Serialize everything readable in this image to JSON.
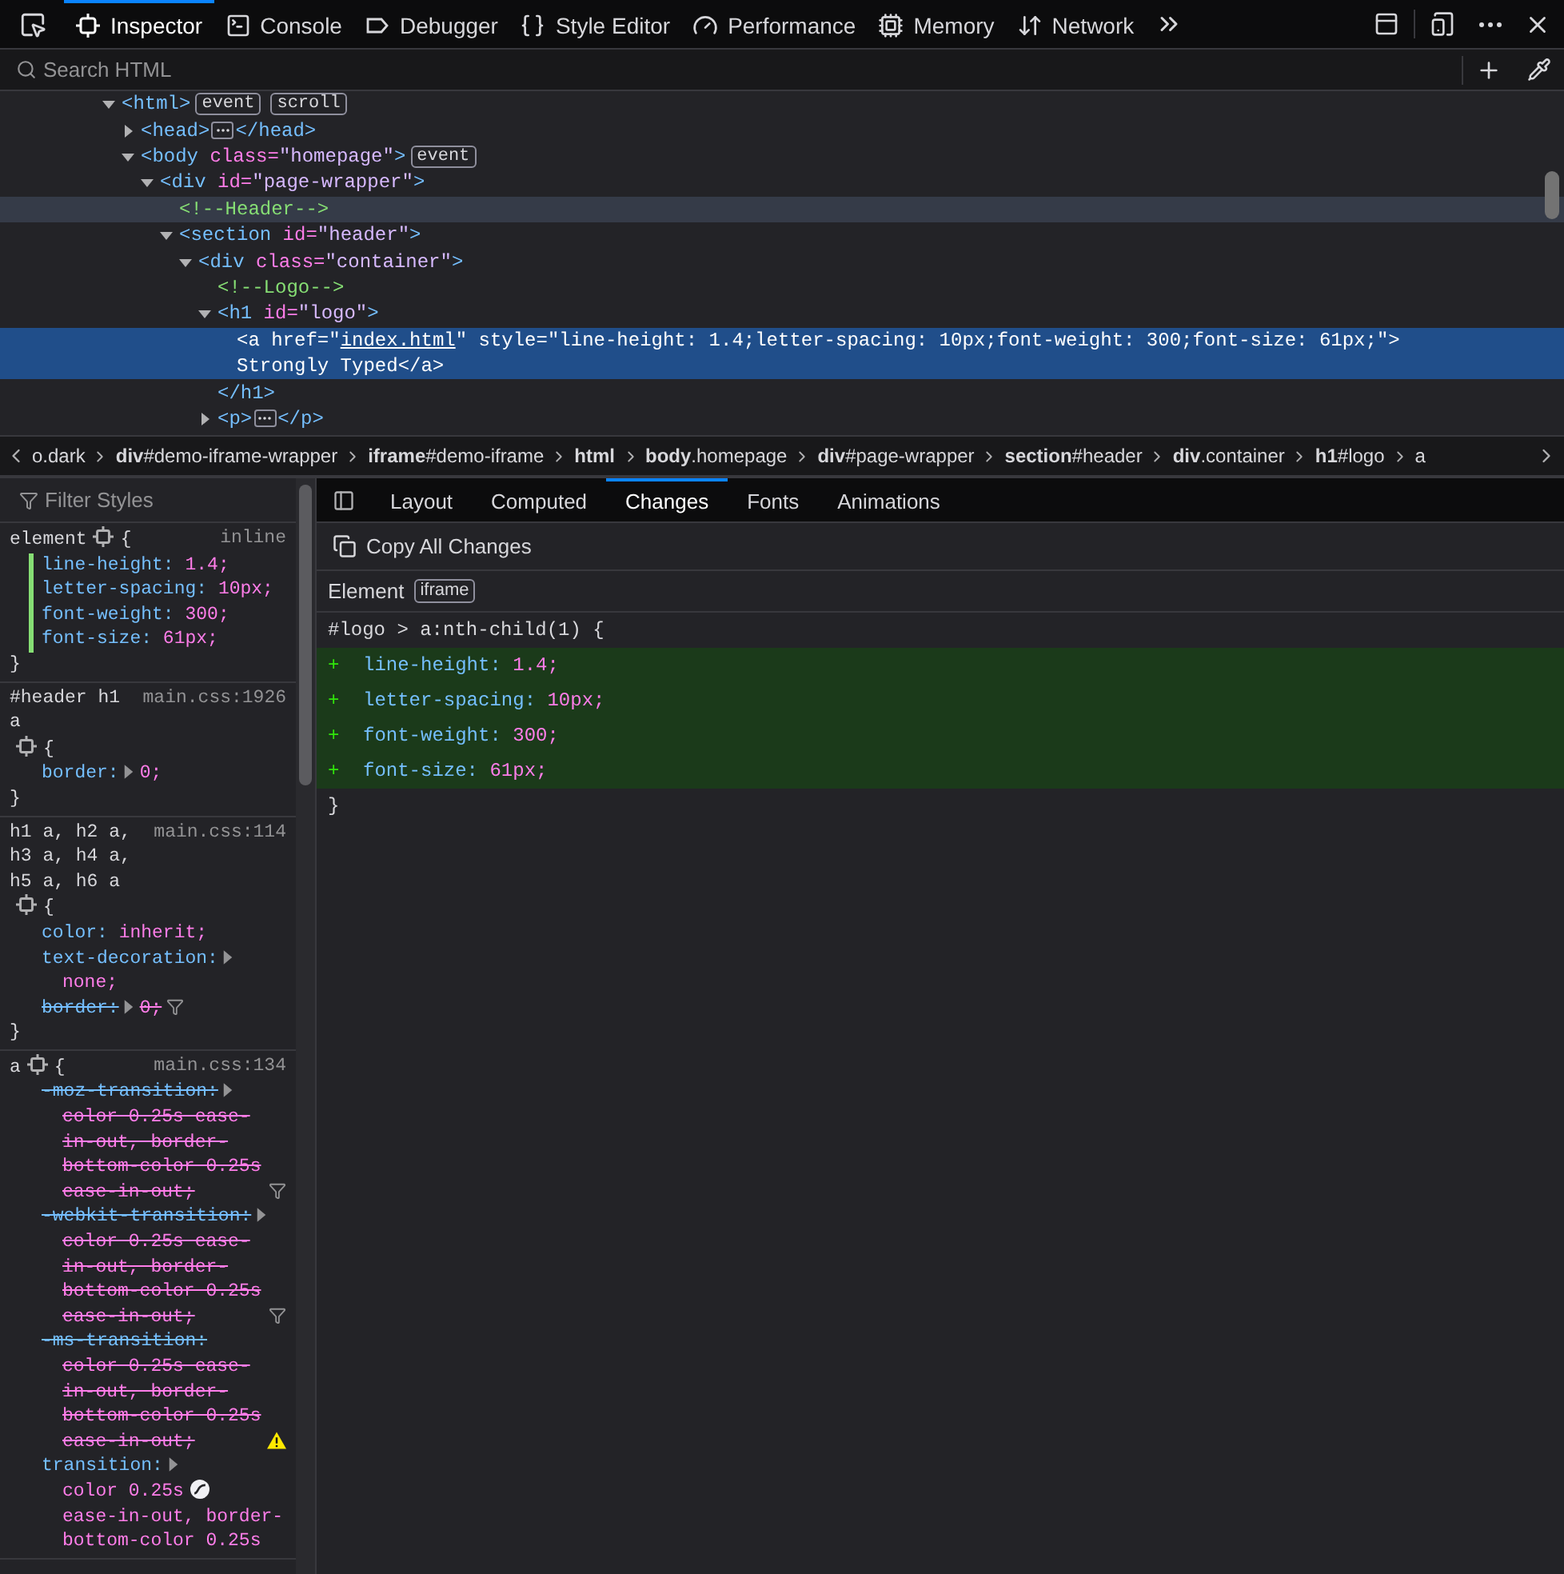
{
  "toolbar": {
    "tabs": [
      {
        "kind": "inspector",
        "label": "Inspector",
        "selected": true
      },
      {
        "kind": "console",
        "label": "Console",
        "selected": false
      },
      {
        "kind": "debugger",
        "label": "Debugger",
        "selected": false
      },
      {
        "kind": "style-editor",
        "label": "Style Editor",
        "selected": false
      },
      {
        "kind": "performance",
        "label": "Performance",
        "selected": false
      },
      {
        "kind": "memory",
        "label": "Memory",
        "selected": false
      },
      {
        "kind": "network",
        "label": "Network",
        "selected": false
      }
    ]
  },
  "search": {
    "placeholder": "Search HTML"
  },
  "markup": {
    "nodes": [
      {
        "expanded": true,
        "selected": false,
        "hovered": false,
        "lines": [
          [
            {
              "kind": "tag",
              "text": "<html>"
            },
            {
              "kind": "badge",
              "text": "event"
            },
            {
              "kind": "badge",
              "text": "scroll"
            }
          ]
        ],
        "children": [
          {
            "expanded": false,
            "selected": false,
            "hovered": false,
            "lines": [
              [
                {
                  "kind": "tag",
                  "text": "<head>"
                },
                {
                  "kind": "more"
                },
                {
                  "kind": "tag",
                  "text": "</head>"
                }
              ]
            ]
          },
          {
            "expanded": true,
            "selected": false,
            "hovered": false,
            "lines": [
              [
                {
                  "kind": "tag",
                  "text": "<body"
                },
                {
                  "kind": "attr",
                  "text": " class="
                },
                {
                  "kind": "value",
                  "text": "\"homepage\""
                },
                {
                  "kind": "tag",
                  "text": ">"
                },
                {
                  "kind": "badge",
                  "text": "event"
                }
              ]
            ],
            "children": [
              {
                "expanded": true,
                "selected": false,
                "hovered": false,
                "lines": [
                  [
                    {
                      "kind": "tag",
                      "text": "<div"
                    },
                    {
                      "kind": "attr",
                      "text": " id="
                    },
                    {
                      "kind": "value",
                      "text": "\"page-wrapper\""
                    },
                    {
                      "kind": "tag",
                      "text": ">"
                    }
                  ]
                ],
                "children": [
                  {
                    "selected": false,
                    "hovered": true,
                    "lines": [
                      [
                        {
                          "kind": "comment",
                          "text": "<!--Header-->"
                        }
                      ]
                    ]
                  },
                  {
                    "expanded": true,
                    "selected": false,
                    "hovered": false,
                    "lines": [
                      [
                        {
                          "kind": "tag",
                          "text": "<section"
                        },
                        {
                          "kind": "attr",
                          "text": " id="
                        },
                        {
                          "kind": "value",
                          "text": "\"header\""
                        },
                        {
                          "kind": "tag",
                          "text": ">"
                        }
                      ]
                    ],
                    "children": [
                      {
                        "expanded": true,
                        "selected": false,
                        "hovered": false,
                        "lines": [
                          [
                            {
                              "kind": "tag",
                              "text": "<div"
                            },
                            {
                              "kind": "attr",
                              "text": " class="
                            },
                            {
                              "kind": "value",
                              "text": "\"container\""
                            },
                            {
                              "kind": "tag",
                              "text": ">"
                            }
                          ]
                        ],
                        "children": [
                          {
                            "selected": false,
                            "hovered": false,
                            "lines": [
                              [
                                {
                                  "kind": "comment",
                                  "text": "<!--Logo-->"
                                }
                              ]
                            ]
                          },
                          {
                            "expanded": true,
                            "selected": false,
                            "hovered": false,
                            "closing": "</h1>",
                            "lines": [
                              [
                                {
                                  "kind": "tag",
                                  "text": "<h1"
                                },
                                {
                                  "kind": "attr",
                                  "text": " id="
                                },
                                {
                                  "kind": "value",
                                  "text": "\"logo\""
                                },
                                {
                                  "kind": "tag",
                                  "text": ">"
                                }
                              ]
                            ],
                            "children": [
                              {
                                "selected": true,
                                "hovered": false,
                                "lines": [
                                  [
                                    {
                                      "kind": "tag",
                                      "text": "<a"
                                    },
                                    {
                                      "kind": "attr",
                                      "text": " href="
                                    },
                                    {
                                      "kind": "value",
                                      "text": "\""
                                    },
                                    {
                                      "kind": "link",
                                      "text": "index.html"
                                    },
                                    {
                                      "kind": "value",
                                      "text": "\""
                                    },
                                    {
                                      "kind": "attr",
                                      "text": " style="
                                    },
                                    {
                                      "kind": "value",
                                      "text": "\"line-height: 1.4;letter-spacing: 10px;font-weight: 300;font-size: 61px;\""
                                    },
                                    {
                                      "kind": "tag",
                                      "text": ">"
                                    }
                                  ],
                                  [
                                    {
                                      "kind": "text",
                                      "text": "Strongly Typed"
                                    },
                                    {
                                      "kind": "tag",
                                      "text": "</a>"
                                    }
                                  ]
                                ]
                              }
                            ]
                          },
                          {
                            "expanded": false,
                            "selected": false,
                            "hovered": false,
                            "lines": [
                              [
                                {
                                  "kind": "tag",
                                  "text": "<p>"
                                },
                                {
                                  "kind": "more"
                                },
                                {
                                  "kind": "tag",
                                  "text": "</p>"
                                }
                              ]
                            ]
                          }
                        ]
                      }
                    ]
                  }
                ]
              }
            ]
          }
        ]
      }
    ]
  },
  "breadcrumbs": [
    "o.dark",
    "**div**#demo-iframe-wrapper",
    "**iframe**#demo-iframe",
    "**html**",
    "**body**.homepage",
    "**div**#page-wrapper",
    "**section**#header",
    "**div**.container",
    "**h1**#logo",
    "a"
  ],
  "rules": {
    "filter": {
      "placeholder": "Filter Styles"
    },
    "items": [
      {
        "selector": "element",
        "source": "inline",
        "open": "{",
        "close": "}",
        "declarations": [
          {
            "kind": "plain",
            "name": "line-height:",
            "value": "1.4;",
            "changed": true,
            "overridden": false,
            "expandable": false
          },
          {
            "kind": "plain",
            "name": "letter-spacing:",
            "value": "10px;",
            "changed": true,
            "overridden": false,
            "expandable": false
          },
          {
            "kind": "plain",
            "name": "font-weight:",
            "value": "300;",
            "changed": true,
            "overridden": false,
            "expandable": false
          },
          {
            "kind": "plain",
            "name": "font-size:",
            "value": "61px;",
            "changed": true,
            "overridden": false,
            "expandable": false
          }
        ]
      },
      {
        "selector": "#header h1 a",
        "source": "main.css:1926",
        "open": "{",
        "close": "}",
        "declarations": [
          {
            "kind": "plain",
            "name": "border:",
            "value": "0;",
            "changed": false,
            "overridden": false,
            "expandable": true
          }
        ]
      },
      {
        "selector": "h1 a, h2 a, h3 a, h4 a, h5 a, h6 a",
        "source": "main.css:114",
        "open": "{",
        "close": "}",
        "declarations": [
          {
            "kind": "plain",
            "name": "color:",
            "value": "inherit;",
            "changed": false,
            "overridden": false,
            "expandable": false
          },
          {
            "kind": "plain",
            "name": "text-decoration:",
            "value": "none;",
            "changed": false,
            "overridden": false,
            "expandable": true
          },
          {
            "kind": "filtered",
            "name": "border:",
            "value": "0;",
            "changed": false,
            "overridden": true,
            "expandable": true
          }
        ]
      },
      {
        "selector": "a",
        "source": "main.css:134",
        "open": "{",
        "declarations": [
          {
            "kind": "filtered",
            "name": "-moz-transition:",
            "value": "color 0.25s ease-in-out, border-bottom-color 0.25s ease-in-out;",
            "changed": false,
            "overridden": true,
            "expandable": true
          },
          {
            "kind": "filtered",
            "name": "-webkit-transition:",
            "value": "color 0.25s ease-in-out, border-bottom-color 0.25s ease-in-out;",
            "changed": false,
            "overridden": true,
            "expandable": true
          },
          {
            "kind": "warning",
            "name": "-ms-transition:",
            "value": "color 0.25s ease-in-out, border-bottom-color 0.25s ease-in-out;",
            "changed": false,
            "overridden": true,
            "expandable": false
          },
          {
            "kind": "timing",
            "name": "transition:",
            "value": "color 0.25s",
            "value_rest": "ease-in-out, border-bottom-color 0.25s",
            "changed": false,
            "overridden": false,
            "expandable": true
          }
        ]
      }
    ]
  },
  "sidebar": {
    "tabs": [
      {
        "label": "Layout",
        "selected": false
      },
      {
        "label": "Computed",
        "selected": false
      },
      {
        "label": "Changes",
        "selected": true
      },
      {
        "label": "Fonts",
        "selected": false
      },
      {
        "label": "Animations",
        "selected": false
      }
    ],
    "copy_button": "Copy All Changes",
    "source": {
      "label": "Element",
      "badge": "iframe"
    },
    "selector": "#logo > a:nth-child(1) {",
    "changes": [
      {
        "marker": "+",
        "name": "line-height:",
        "value": "1.4;"
      },
      {
        "marker": "+",
        "name": "letter-spacing:",
        "value": "10px;"
      },
      {
        "marker": "+",
        "name": "font-weight:",
        "value": "300;"
      },
      {
        "marker": "+",
        "name": "font-size:",
        "value": "61px;"
      }
    ],
    "close": "}"
  }
}
